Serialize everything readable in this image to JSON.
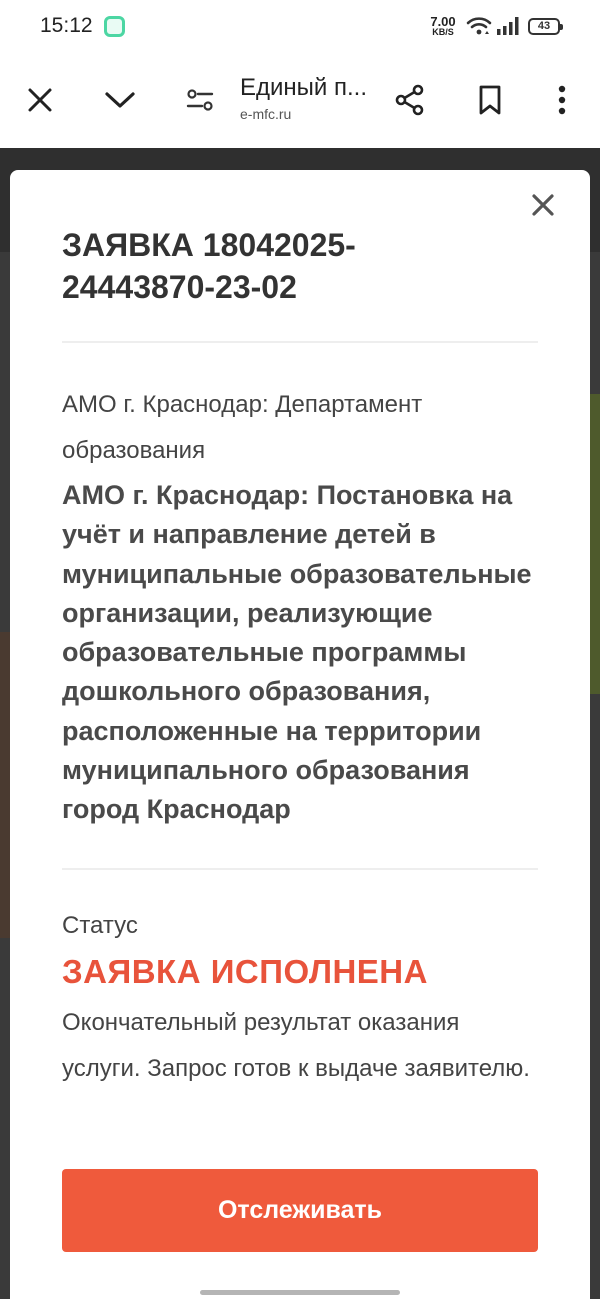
{
  "status_bar": {
    "time": "15:12",
    "net_speed_value": "7.00",
    "net_speed_unit": "KB/S",
    "battery": "43"
  },
  "browser": {
    "tab_title": "Единый п...",
    "domain": "e-mfc.ru"
  },
  "application": {
    "title": "ЗАЯВКА 18042025-24443870-23-02",
    "department": "АМО г. Краснодар: Департамент образования",
    "service": "АМО г. Краснодар: Постановка на учёт и направление детей в муниципальные образовательные организации, реализующие образовательные программы дошкольного образования, расположенные на территории муниципального образования город Краснодар",
    "status_label": "Статус",
    "status_value": "ЗАЯВКА ИСПОЛНЕНА",
    "status_description": "Окончательный результат оказания услуги. Запрос готов к выдаче заявителю.",
    "track_button": "Отслеживать"
  },
  "colors": {
    "accent": "#ef5a3c",
    "status_red": "#e8533b",
    "overlay": "#3a3a3a"
  },
  "icons": {
    "toolbar": [
      "close-icon",
      "chevron-down-icon",
      "page-settings-icon",
      "share-icon",
      "bookmark-icon",
      "more-vert-icon"
    ],
    "modal": [
      "close-icon"
    ]
  }
}
